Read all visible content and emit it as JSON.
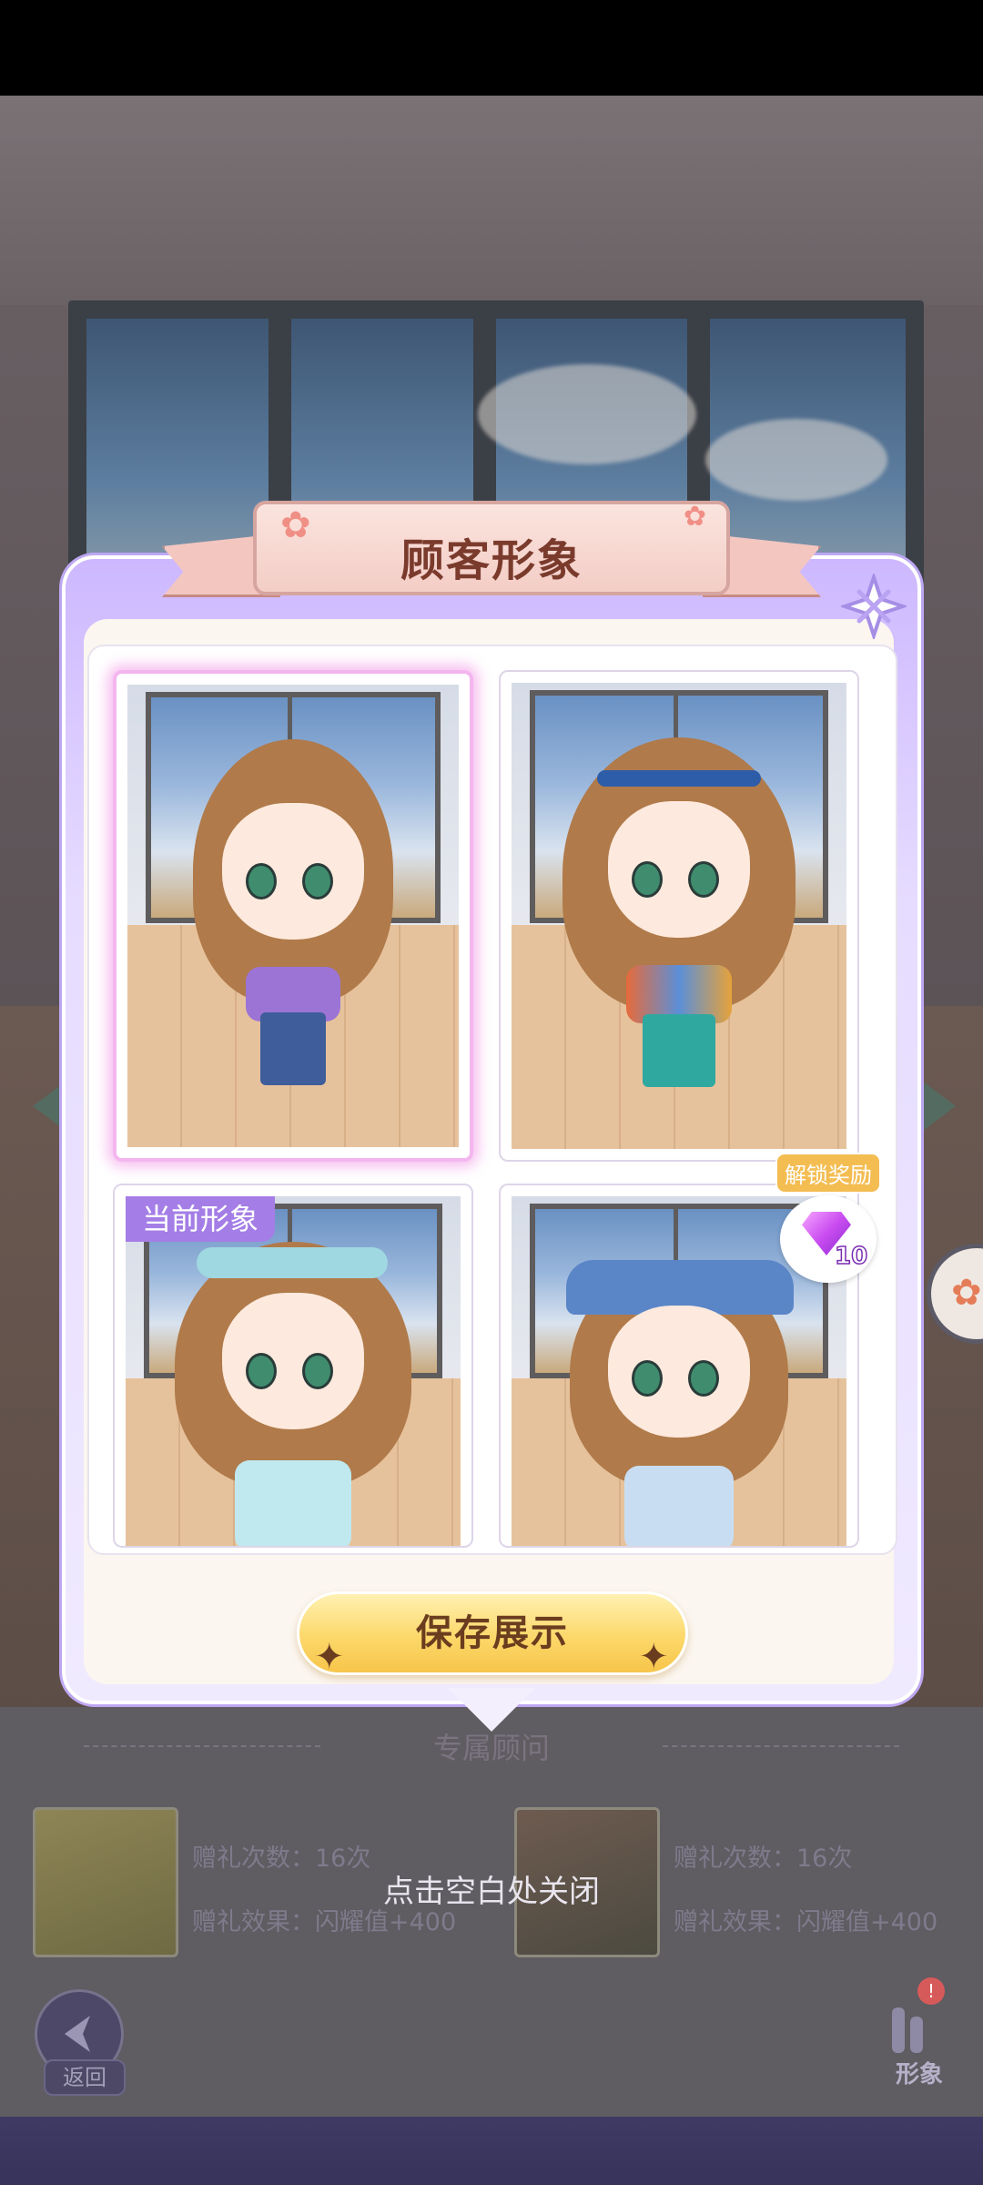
{
  "dialog": {
    "title": "顾客形象",
    "current_tag": "当前形象",
    "reward": {
      "label": "解锁奖励",
      "gem_count": "10"
    },
    "save_button": "保存展示"
  },
  "hint": "点击空白处关闭",
  "background": {
    "section_title": "专属顾问",
    "consultants": [
      {
        "gift_count": "赠礼次数：16次",
        "gift_effect": "赠礼效果：闪耀值+400"
      },
      {
        "gift_count": "赠礼次数：16次",
        "gift_effect": "赠礼效果：闪耀值+400"
      }
    ],
    "back_label": "返回",
    "look_label": "形象",
    "badge": "!"
  },
  "colors": {
    "dialog_border": "#bda7f3",
    "tag_bg": "#a47ee6",
    "button_gold": "#fcd86a",
    "title_text": "#7a3b2d"
  }
}
